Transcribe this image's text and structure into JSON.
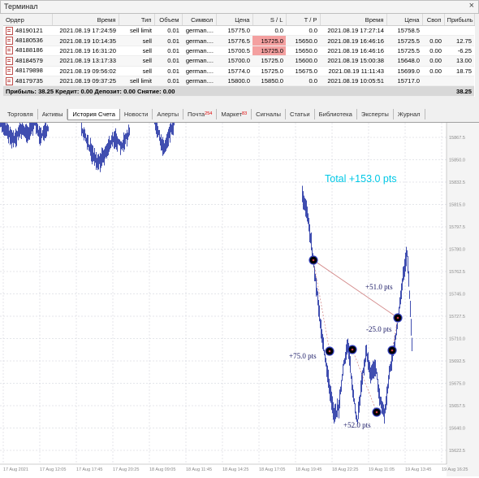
{
  "terminal": {
    "title": "Терминал",
    "close_glyph": "×",
    "columns": [
      "Ордер",
      "Время",
      "Тип",
      "Объем",
      "Символ",
      "Цена",
      "S / L",
      "T / P",
      "Время",
      "Цена",
      "Своп",
      "Прибыль"
    ],
    "rows": [
      {
        "order": "48190121",
        "time": "2021.08.19 17:24:59",
        "type": "sell limit",
        "volume": "0.01",
        "symbol": "german....",
        "price": "15775.0",
        "sl": "0.0",
        "tp": "0.0",
        "close_time": "2021.08.19 17:27:14",
        "close_price": "15758.5",
        "swap": "",
        "profit": ""
      },
      {
        "order": "48180536",
        "time": "2021.08.19 10:14:35",
        "type": "sell",
        "volume": "0.01",
        "symbol": "german....",
        "price": "15776.5",
        "sl": "15725.0",
        "tp": "15650.0",
        "close_time": "2021.08.19 16:46:16",
        "close_price": "15725.5",
        "swap": "0.00",
        "profit": "12.75"
      },
      {
        "order": "48188186",
        "time": "2021.08.19 16:31:20",
        "type": "sell",
        "volume": "0.01",
        "symbol": "german....",
        "price": "15700.5",
        "sl": "15725.0",
        "tp": "15650.0",
        "close_time": "2021.08.19 16:46:16",
        "close_price": "15725.5",
        "swap": "0.00",
        "profit": "-6.25"
      },
      {
        "order": "48184579",
        "time": "2021.08.19 13:17:33",
        "type": "sell",
        "volume": "0.01",
        "symbol": "german....",
        "price": "15700.0",
        "sl": "15725.0",
        "tp": "15600.0",
        "close_time": "2021.08.19 15:00:38",
        "close_price": "15648.0",
        "swap": "0.00",
        "profit": "13.00"
      },
      {
        "order": "48179898",
        "time": "2021.08.19 09:56:02",
        "type": "sell",
        "volume": "0.01",
        "symbol": "german....",
        "price": "15774.0",
        "sl": "15725.0",
        "tp": "15675.0",
        "close_time": "2021.08.19 11:11:43",
        "close_price": "15699.0",
        "swap": "0.00",
        "profit": "18.75"
      },
      {
        "order": "48179735",
        "time": "2021.08.19 09:37:25",
        "type": "sell limit",
        "volume": "0.01",
        "symbol": "german....",
        "price": "15800.0",
        "sl": "15850.0",
        "tp": "0.0",
        "close_time": "2021.08.19 10:05:51",
        "close_price": "15717.0",
        "swap": "",
        "profit": ""
      }
    ],
    "summary": {
      "text": "Прибыль: 38.25  Кредит: 0.00  Депозит: 0.00  Снятие: 0.00",
      "total": "38.25"
    },
    "tabs": [
      {
        "label": "Торговля"
      },
      {
        "label": "Активы"
      },
      {
        "label": "История Счета",
        "active": true
      },
      {
        "label": "Новости"
      },
      {
        "label": "Алерты"
      },
      {
        "label": "Почта",
        "badge": "254"
      },
      {
        "label": "Маркет",
        "badge": "83"
      },
      {
        "label": "Сигналы"
      },
      {
        "label": "Статьи"
      },
      {
        "label": "Библиотека"
      },
      {
        "label": "Эксперты"
      },
      {
        "label": "Журнал"
      }
    ]
  },
  "chart": {
    "total_label": "Total +153.0 pts",
    "annotations": [
      "+51.0 pts",
      "-25.0 pts",
      "+75.0 pts",
      "+52.0 pts"
    ],
    "price_axis": [
      "15867.5",
      "15850.0",
      "15832.5",
      "15815.0",
      "15797.5",
      "15780.0",
      "15762.5",
      "15745.0",
      "15727.5",
      "15710.0",
      "15692.5",
      "15675.0",
      "15657.5",
      "15640.0",
      "15622.5"
    ],
    "time_axis": [
      "17 Aug 2021",
      "17 Aug 12:05",
      "17 Aug 17:45",
      "17 Aug 20:25",
      "18 Aug 09:05",
      "18 Aug 11:45",
      "18 Aug 14:25",
      "18 Aug 17:05",
      "18 Aug 19:45",
      "18 Aug 22:25",
      "19 Aug 11:05",
      "19 Aug 13:45",
      "19 Aug 16:25"
    ],
    "colors": {
      "bars": "#2b3aa8",
      "trade_line": "#d08080",
      "total": "#00c8e6",
      "grid": "#c9ccd6",
      "marker": "#000000"
    }
  }
}
